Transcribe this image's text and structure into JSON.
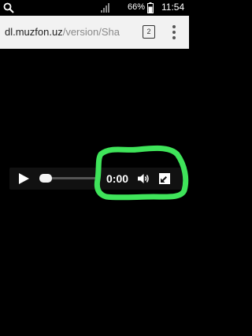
{
  "status_bar": {
    "battery_percent": "66%",
    "time": "11:54",
    "icons": [
      "search-icon",
      "signal-icon",
      "battery-icon"
    ]
  },
  "browser": {
    "url_domain": "dl.muzfon.uz",
    "url_path": "/version/Sha",
    "tab_count": "2",
    "icons": [
      "tabs-icon",
      "overflow-menu-icon"
    ]
  },
  "player": {
    "time": "0:00",
    "progress": 0,
    "icons": [
      "play-icon",
      "volume-icon",
      "fullscreen-icon"
    ]
  },
  "colors": {
    "background": "#000000",
    "address_bar": "#f2f2f2",
    "highlight": "#3fe45a"
  }
}
